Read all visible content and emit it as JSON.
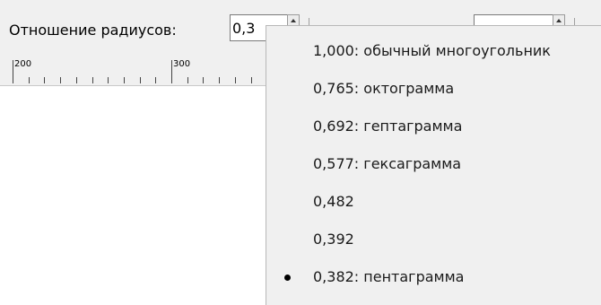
{
  "toolbar": {
    "ratio_label": "Отношение радиусов:",
    "ratio_value": "0,3"
  },
  "ruler": {
    "labels": [
      "200",
      "300"
    ]
  },
  "menu": {
    "items": [
      {
        "label": "1,000: обычный многоугольник",
        "selected": false
      },
      {
        "label": "0,765: октограмма",
        "selected": false
      },
      {
        "label": "0,692: гептаграмма",
        "selected": false
      },
      {
        "label": "0,577: гексаграмма",
        "selected": false
      },
      {
        "label": "0,482",
        "selected": false
      },
      {
        "label": "0,392",
        "selected": false
      },
      {
        "label": "0,382: пентаграмма",
        "selected": true
      }
    ]
  }
}
